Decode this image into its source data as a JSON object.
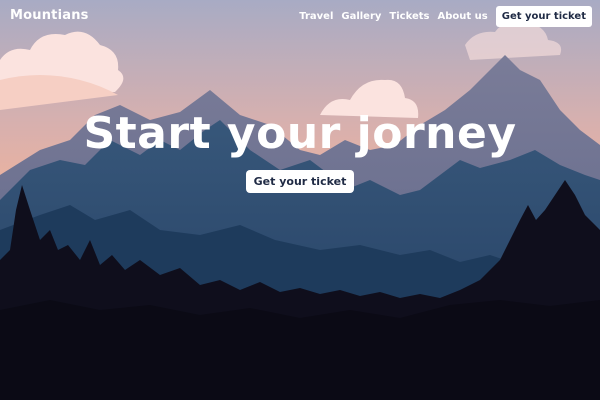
{
  "navbar": {
    "logo": "Mountians",
    "links": [
      {
        "label": "Travel"
      },
      {
        "label": "Gallery"
      },
      {
        "label": "Tickets"
      },
      {
        "label": "About us"
      }
    ],
    "cta_label": "Get your ticket"
  },
  "hero": {
    "title": "Start your jorney",
    "cta_label": "Get your ticket"
  },
  "colors": {
    "sky_top": "#a7abc3",
    "sky_bottom": "#f7b394",
    "cloud": "#fbe1de",
    "mountain_far": "#6e7392",
    "mountain_mid": "#2d4d6f",
    "mountain_near": "#1d3a5a",
    "forest": "#0e0d1a",
    "button_text": "#1f2a44"
  }
}
